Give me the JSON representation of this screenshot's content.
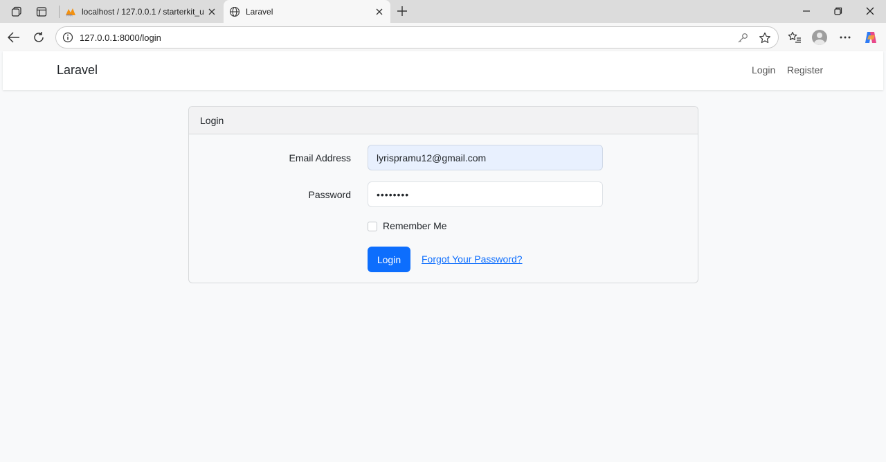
{
  "browser": {
    "tabs": [
      {
        "title": "localhost / 127.0.0.1 / starterkit_u",
        "favicon": "phpmyadmin-icon"
      },
      {
        "title": "Laravel",
        "favicon": "globe-icon"
      }
    ],
    "url": "127.0.0.1:8000/login"
  },
  "navbar": {
    "brand": "Laravel",
    "links": {
      "login": "Login",
      "register": "Register"
    }
  },
  "login_card": {
    "header": "Login",
    "email_label": "Email Address",
    "email_value": "lyrispramu12@gmail.com",
    "password_label": "Password",
    "password_value": "••••••••",
    "remember_label": "Remember Me",
    "remember_checked": false,
    "submit_label": "Login",
    "forgot_link": "Forgot Your Password?"
  },
  "colors": {
    "primary": "#0d6efd",
    "autofill": "#e8f0fe"
  }
}
